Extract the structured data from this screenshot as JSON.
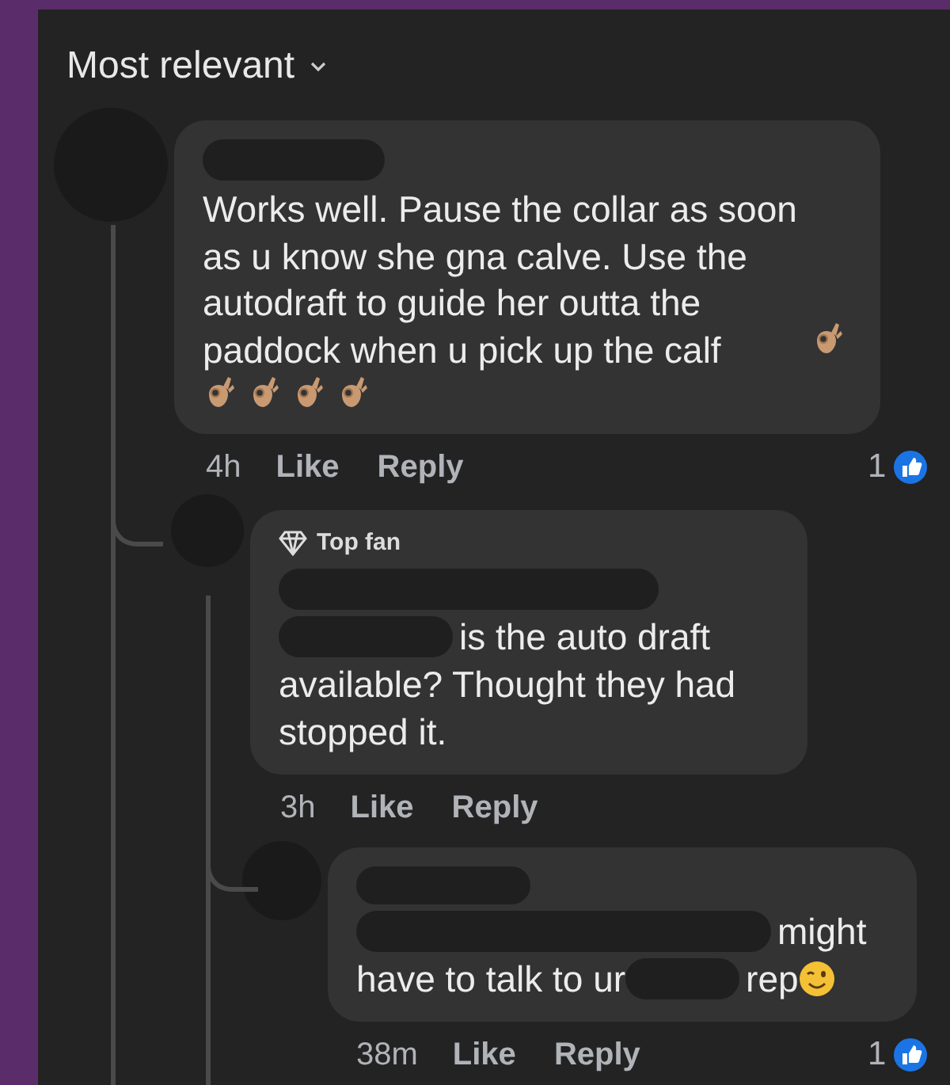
{
  "sort": {
    "label": "Most relevant"
  },
  "comment": {
    "body": "Works well. Pause the collar as soon as u know she gna calve. Use the autodraft to guide her outta the paddock when u pick up the calf",
    "time": "4h",
    "like": "Like",
    "reply": "Reply",
    "reactions": "1",
    "replies": [
      {
        "badge": "Top fan",
        "lines": [
          [
            {
              "kind": "redacted"
            }
          ],
          [
            {
              "kind": "redacted"
            },
            {
              "kind": "text",
              "text": "is the auto draft"
            }
          ],
          [
            {
              "kind": "text",
              "text": "available? Thought they had"
            }
          ],
          [
            {
              "kind": "text",
              "text": "stopped it."
            }
          ]
        ],
        "time": "3h",
        "like": "Like",
        "reply": "Reply"
      },
      {
        "lines": [
          [
            {
              "kind": "redacted"
            },
            {
              "kind": "text",
              "text": "might"
            }
          ],
          [
            {
              "kind": "text",
              "text": "have to talk to ur"
            },
            {
              "kind": "redacted"
            },
            {
              "kind": "text",
              "text": "rep"
            },
            {
              "kind": "wink"
            }
          ]
        ],
        "time": "38m",
        "like": "Like",
        "reply": "Reply",
        "reactions": "1"
      }
    ]
  }
}
